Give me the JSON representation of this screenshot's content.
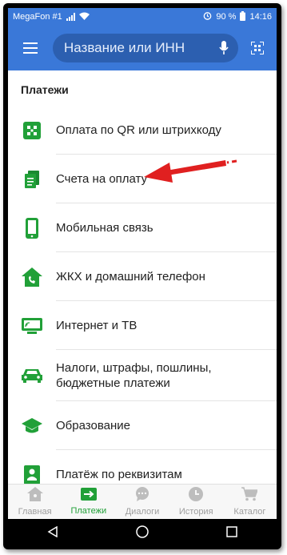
{
  "status_bar": {
    "carrier": "MegaFon #1",
    "battery": "90 %",
    "time": "14:16"
  },
  "header": {
    "search_placeholder": "Название или ИНН"
  },
  "section": {
    "title": "Платежи"
  },
  "items": [
    {
      "label": "Оплата по QR или штрихкоду",
      "icon": "qr-scan-icon"
    },
    {
      "label": "Счета на оплату",
      "icon": "invoices-icon"
    },
    {
      "label": "Мобильная связь",
      "icon": "mobile-phone-icon"
    },
    {
      "label": "ЖКХ и домашний телефон",
      "icon": "house-phone-icon"
    },
    {
      "label": "Интернет и ТВ",
      "icon": "tv-icon"
    },
    {
      "label": "Налоги, штрафы, пошлины, бюджетные платежи",
      "icon": "car-icon"
    },
    {
      "label": "Образование",
      "icon": "graduation-cap-icon"
    },
    {
      "label": "Платёж по реквизитам",
      "icon": "requisites-icon"
    }
  ],
  "bottom_nav": [
    {
      "label": "Главная",
      "icon": "home-icon",
      "active": false
    },
    {
      "label": "Платежи",
      "icon": "payments-arrow-icon",
      "active": true
    },
    {
      "label": "Диалоги",
      "icon": "chat-icon",
      "active": false
    },
    {
      "label": "История",
      "icon": "clock-icon",
      "active": false
    },
    {
      "label": "Каталог",
      "icon": "cart-icon",
      "active": false
    }
  ],
  "colors": {
    "header_blue": "#3a78d8",
    "accent_green": "#21a038",
    "arrow_red": "#e02020",
    "nav_gray": "#9e9e9e"
  }
}
